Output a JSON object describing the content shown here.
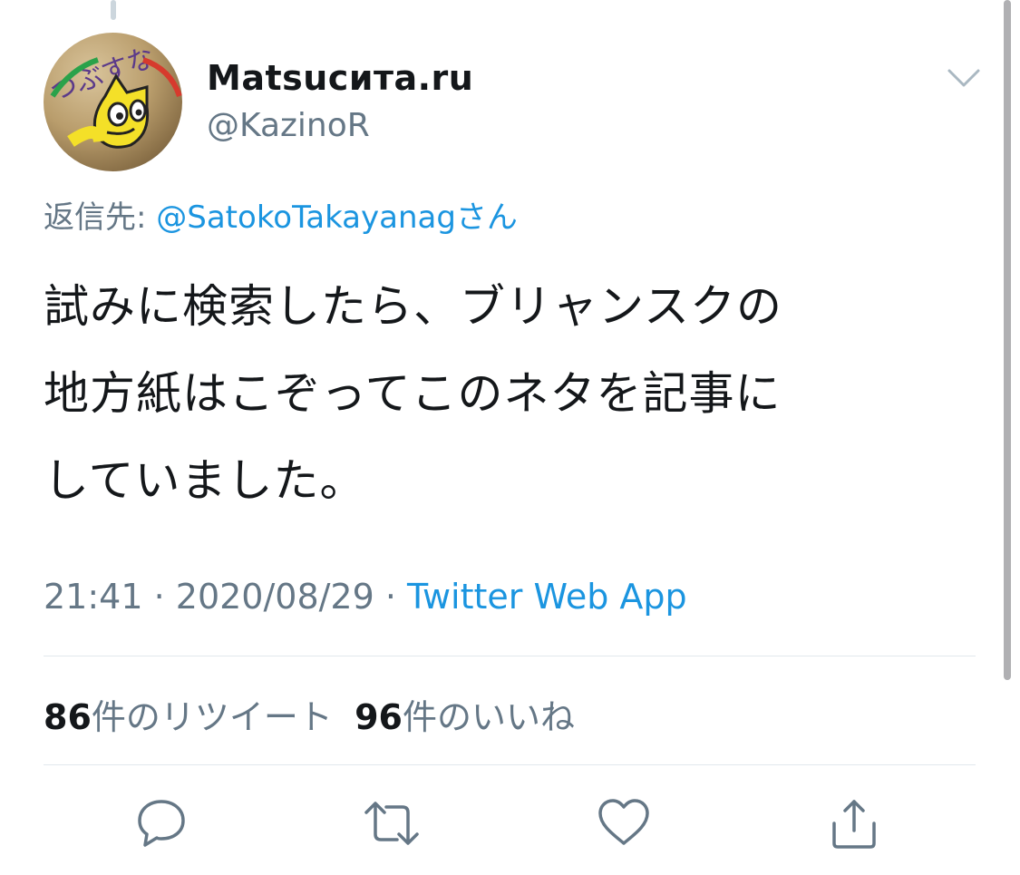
{
  "author": {
    "display_name": "Matsucита.ru",
    "handle": "@KazinoR",
    "avatar_text": "つぶすな"
  },
  "reply": {
    "prefix": "返信先: ",
    "target": "@SatokoTakayanagさん"
  },
  "tweet": {
    "lines": [
      "試みに検索したら、ブリャンスクの",
      "地方紙はこぞってこのネタを記事に",
      "していました。"
    ]
  },
  "meta": {
    "time": "21:41",
    "separator": " · ",
    "date": "2020/08/29",
    "source": "Twitter Web App"
  },
  "stats": {
    "retweet_count": "86",
    "retweet_label": "件のリツイート",
    "like_count": "96",
    "like_label": "件のいいね"
  },
  "actions": [
    "reply-icon",
    "retweet-icon",
    "like-icon",
    "share-icon"
  ],
  "colors": {
    "link": "#1b95e0",
    "muted": "#657786",
    "text": "#14171a"
  }
}
